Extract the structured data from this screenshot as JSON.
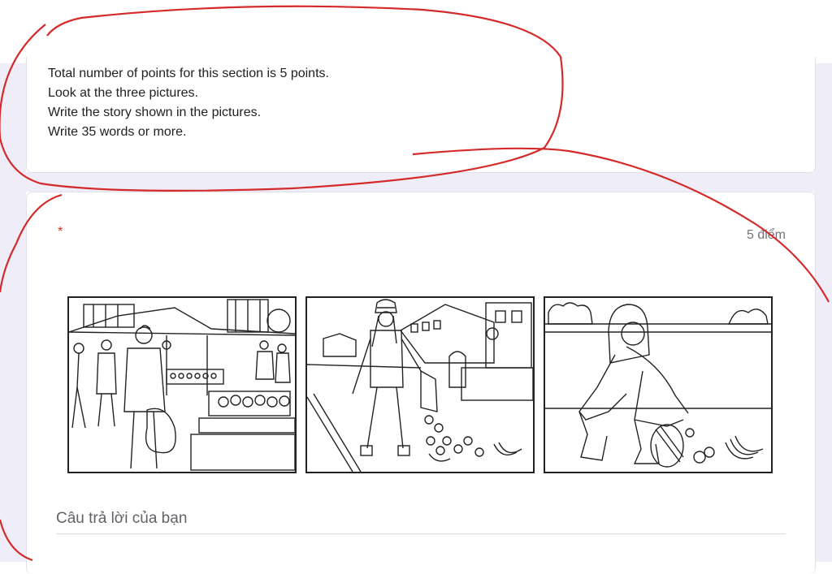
{
  "section": {
    "description_lines": [
      "Total number of points for this section is 5 points.",
      "Look at the three pictures.",
      "Write the story shown in the pictures.",
      "Write 35 words or more."
    ]
  },
  "question": {
    "required_mark": "*",
    "points_label": "5 điểm",
    "answer_placeholder": "Câu trả lời của bạn"
  },
  "pictures": [
    {
      "icon": "market-scene-illustration"
    },
    {
      "icon": "girl-dropping-fruit-illustration"
    },
    {
      "icon": "girl-picking-up-fruit-illustration"
    }
  ],
  "colors": {
    "annotation": "#d42a2a",
    "background_lavender": "#efedf8",
    "required": "#d93025"
  }
}
